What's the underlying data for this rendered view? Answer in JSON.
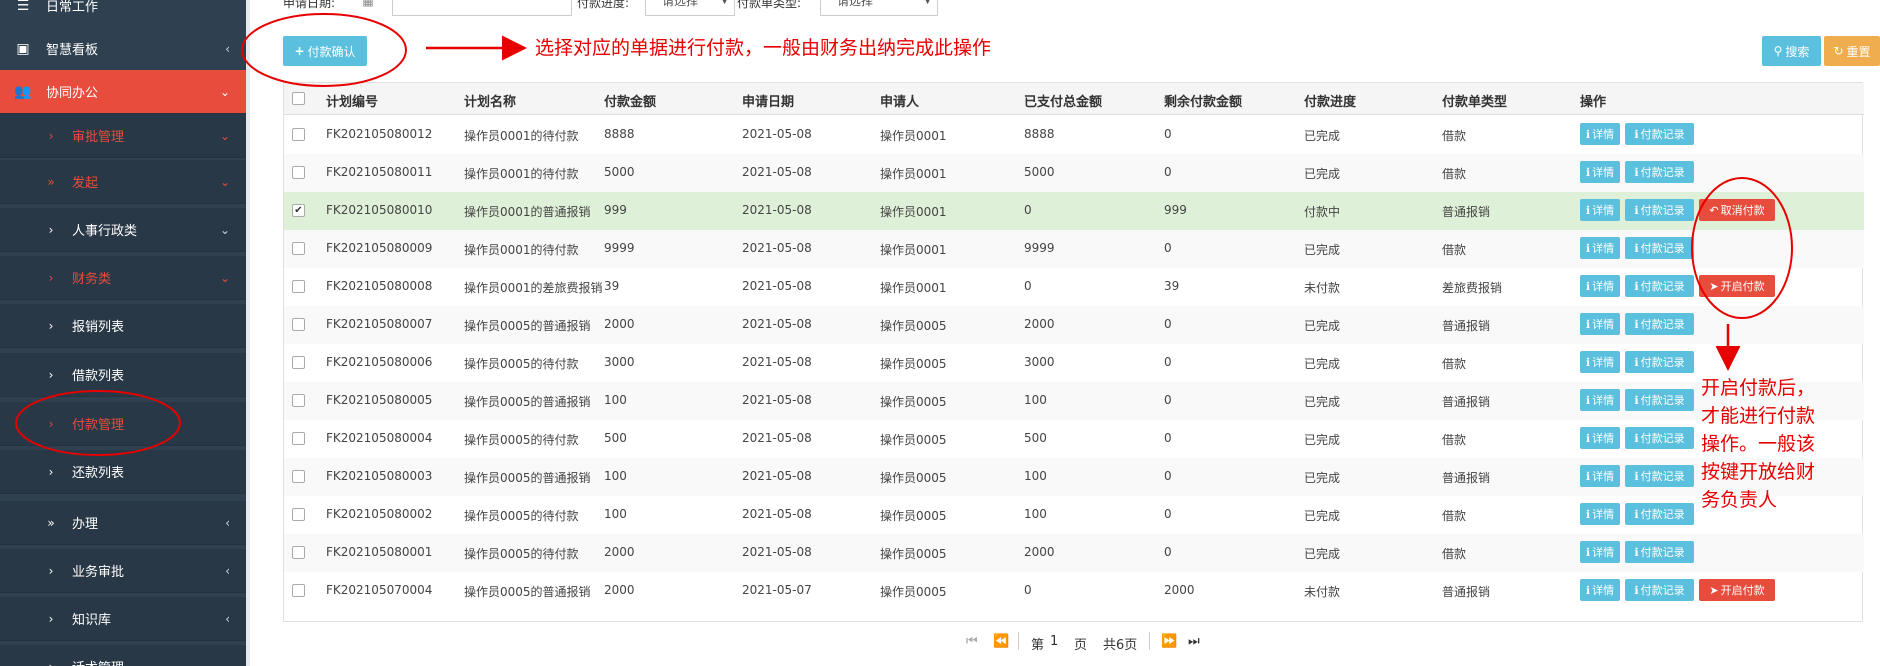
{
  "sidebar": {
    "items": [
      {
        "label": "日常工作",
        "icon": "list-icon",
        "ico": "☰",
        "arrow": "",
        "kind": "top"
      },
      {
        "label": "智慧看板",
        "icon": "dashboard-icon",
        "ico": "▣",
        "arrow": "‹",
        "kind": "top"
      },
      {
        "label": "协同办公",
        "icon": "users-icon",
        "ico": "👥",
        "arrow": "⌄",
        "kind": "active"
      },
      {
        "label": "审批管理",
        "icon": "angle-right-icon",
        "ico": "›",
        "arrow": "⌄",
        "kind": "sub red"
      },
      {
        "label": "发起",
        "icon": "double-angle-right-icon",
        "ico": "»",
        "arrow": "⌄",
        "kind": "sub red"
      },
      {
        "label": "人事行政类",
        "icon": "angle-right-icon",
        "ico": "›",
        "arrow": "⌄",
        "kind": "sub"
      },
      {
        "label": "财务类",
        "icon": "angle-right-icon",
        "ico": "›",
        "arrow": "⌄",
        "kind": "sub red"
      },
      {
        "label": "报销列表",
        "icon": "angle-right-icon",
        "ico": "›",
        "arrow": "",
        "kind": "sub"
      },
      {
        "label": "借款列表",
        "icon": "angle-right-icon",
        "ico": "›",
        "arrow": "",
        "kind": "sub"
      },
      {
        "label": "付款管理",
        "icon": "angle-right-icon",
        "ico": "›",
        "arrow": "",
        "kind": "sub red"
      },
      {
        "label": "还款列表",
        "icon": "angle-right-icon",
        "ico": "›",
        "arrow": "",
        "kind": "sub"
      },
      {
        "label": "办理",
        "icon": "double-angle-right-icon",
        "ico": "»",
        "arrow": "‹",
        "kind": "sub"
      },
      {
        "label": "业务审批",
        "icon": "angle-right-icon",
        "ico": "›",
        "arrow": "‹",
        "kind": "sub"
      },
      {
        "label": "知识库",
        "icon": "angle-right-icon",
        "ico": "›",
        "arrow": "‹",
        "kind": "sub"
      },
      {
        "label": "话术管理",
        "icon": "angle-right-icon",
        "ico": "›",
        "arrow": "",
        "kind": "sub"
      }
    ]
  },
  "filters": {
    "apply_date_label": "申请日期:",
    "progress_label": "付款进度:",
    "progress_value": "请选择",
    "type_label": "付款单类型:",
    "type_value": "请选择"
  },
  "toolbar": {
    "pay_confirm": "付款确认",
    "search": "搜索",
    "reset": "重置"
  },
  "table": {
    "headers": [
      "计划编号",
      "计划名称",
      "付款金额",
      "申请日期",
      "申请人",
      "已支付总金额",
      "剩余付款金额",
      "付款进度",
      "付款单类型",
      "操作"
    ],
    "action_detail": "详情",
    "action_record": "付款记录",
    "rows": [
      {
        "id": "FK202105080012",
        "name": "操作员0001的待付款",
        "amount": "8888",
        "date": "2021-05-08",
        "applicant": "操作员0001",
        "paid": "8888",
        "remain": "0",
        "progress": "已完成",
        "type": "借款",
        "checked": false,
        "extra": ""
      },
      {
        "id": "FK202105080011",
        "name": "操作员0001的待付款",
        "amount": "5000",
        "date": "2021-05-08",
        "applicant": "操作员0001",
        "paid": "5000",
        "remain": "0",
        "progress": "已完成",
        "type": "借款",
        "checked": false,
        "extra": ""
      },
      {
        "id": "FK202105080010",
        "name": "操作员0001的普通报销",
        "amount": "999",
        "date": "2021-05-08",
        "applicant": "操作员0001",
        "paid": "0",
        "remain": "999",
        "progress": "付款中",
        "type": "普通报销",
        "checked": true,
        "extra": "取消付款"
      },
      {
        "id": "FK202105080009",
        "name": "操作员0001的待付款",
        "amount": "9999",
        "date": "2021-05-08",
        "applicant": "操作员0001",
        "paid": "9999",
        "remain": "0",
        "progress": "已完成",
        "type": "借款",
        "checked": false,
        "extra": ""
      },
      {
        "id": "FK202105080008",
        "name": "操作员0001的差旅费报销",
        "amount": "39",
        "date": "2021-05-08",
        "applicant": "操作员0001",
        "paid": "0",
        "remain": "39",
        "progress": "未付款",
        "type": "差旅费报销",
        "checked": false,
        "extra": "开启付款"
      },
      {
        "id": "FK202105080007",
        "name": "操作员0005的普通报销",
        "amount": "2000",
        "date": "2021-05-08",
        "applicant": "操作员0005",
        "paid": "2000",
        "remain": "0",
        "progress": "已完成",
        "type": "普通报销",
        "checked": false,
        "extra": ""
      },
      {
        "id": "FK202105080006",
        "name": "操作员0005的待付款",
        "amount": "3000",
        "date": "2021-05-08",
        "applicant": "操作员0005",
        "paid": "3000",
        "remain": "0",
        "progress": "已完成",
        "type": "借款",
        "checked": false,
        "extra": ""
      },
      {
        "id": "FK202105080005",
        "name": "操作员0005的普通报销",
        "amount": "100",
        "date": "2021-05-08",
        "applicant": "操作员0005",
        "paid": "100",
        "remain": "0",
        "progress": "已完成",
        "type": "普通报销",
        "checked": false,
        "extra": ""
      },
      {
        "id": "FK202105080004",
        "name": "操作员0005的待付款",
        "amount": "500",
        "date": "2021-05-08",
        "applicant": "操作员0005",
        "paid": "500",
        "remain": "0",
        "progress": "已完成",
        "type": "借款",
        "checked": false,
        "extra": ""
      },
      {
        "id": "FK202105080003",
        "name": "操作员0005的普通报销",
        "amount": "100",
        "date": "2021-05-08",
        "applicant": "操作员0005",
        "paid": "100",
        "remain": "0",
        "progress": "已完成",
        "type": "普通报销",
        "checked": false,
        "extra": ""
      },
      {
        "id": "FK202105080002",
        "name": "操作员0005的待付款",
        "amount": "100",
        "date": "2021-05-08",
        "applicant": "操作员0005",
        "paid": "100",
        "remain": "0",
        "progress": "已完成",
        "type": "借款",
        "checked": false,
        "extra": ""
      },
      {
        "id": "FK202105080001",
        "name": "操作员0005的待付款",
        "amount": "2000",
        "date": "2021-05-08",
        "applicant": "操作员0005",
        "paid": "2000",
        "remain": "0",
        "progress": "已完成",
        "type": "借款",
        "checked": false,
        "extra": ""
      },
      {
        "id": "FK202105070004",
        "name": "操作员0005的普通报销",
        "amount": "2000",
        "date": "2021-05-07",
        "applicant": "操作员0005",
        "paid": "0",
        "remain": "2000",
        "progress": "未付款",
        "type": "普通报销",
        "checked": false,
        "extra": "开启付款"
      }
    ]
  },
  "pager": {
    "page_prefix": "第",
    "page_num": "1",
    "page_suffix": "页",
    "total": "共6页"
  },
  "annotations": {
    "note1": "选择对应的单据进行付款，一般由财务出纳完成此操作",
    "note2_lines": [
      "开启付款后，",
      "才能进行付款",
      "操作。一般该",
      "按键开放给财",
      "务负责人"
    ]
  },
  "colors": {
    "sidebar_bg": "#2f4050",
    "active": "#e74c3c",
    "info": "#5bc0de",
    "warning": "#f0ad4e",
    "selected_row": "#dff0d8",
    "annotation": "#e60000"
  }
}
